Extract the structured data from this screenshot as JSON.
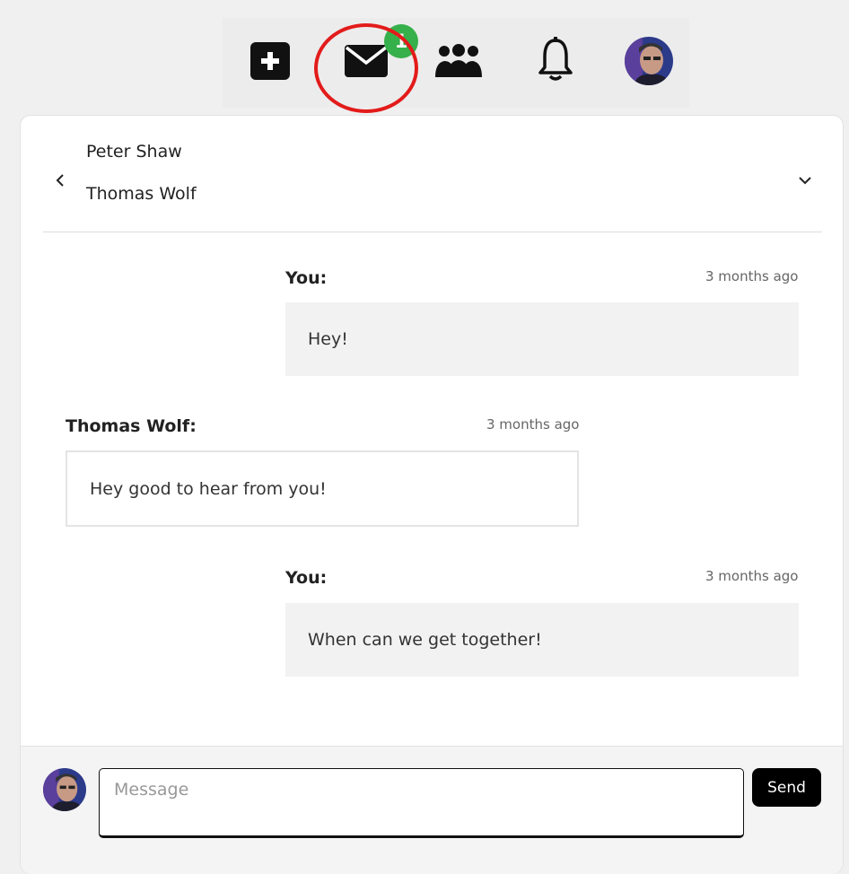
{
  "nav": {
    "unread_badge": "1",
    "icons": [
      "plus-icon",
      "envelope-icon",
      "users-icon",
      "bell-icon",
      "avatar"
    ]
  },
  "conversation": {
    "participants": [
      "Peter Shaw",
      "Thomas Wolf"
    ]
  },
  "messages": [
    {
      "author": "You:",
      "time": "3 months ago",
      "text": "Hey!"
    },
    {
      "author": "Thomas Wolf:",
      "time": "3 months ago",
      "text": "Hey good to hear from you!"
    },
    {
      "author": "You:",
      "time": "3 months ago",
      "text": "When can we get together!"
    }
  ],
  "composer": {
    "placeholder": "Message",
    "value": "",
    "send_label": "Send"
  },
  "colors": {
    "badge": "#36b04a",
    "highlight_ring": "#e31b1b",
    "button": "#000000"
  }
}
